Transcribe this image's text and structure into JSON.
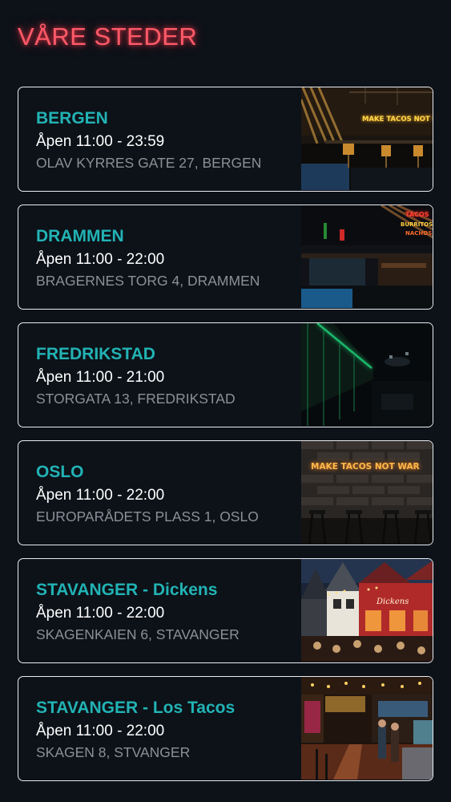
{
  "header": {
    "title": "VÅRE STEDER"
  },
  "colors": {
    "background": "#0c1218",
    "title_neon": "#ff5a68",
    "location_name": "#22b3b5",
    "hours": "#ffffff",
    "address": "#8a9099",
    "card_border": "#e9edf2"
  },
  "locations": [
    {
      "name": "BERGEN",
      "hours": "Åpen 11:00 - 23:59",
      "address": "OLAV KYRRES GATE 27, BERGEN",
      "photo_sign": "MAKE TACOS NOT WAR"
    },
    {
      "name": "DRAMMEN",
      "hours": "Åpen 11:00 - 22:00",
      "address": "BRAGERNES TORG 4, DRAMMEN",
      "photo_sign": "TACOS BURRITOS NACHOS"
    },
    {
      "name": "FREDRIKSTAD",
      "hours": "Åpen 11:00 - 21:00",
      "address": "STORGATA 13, FREDRIKSTAD",
      "photo_sign": ""
    },
    {
      "name": "OSLO",
      "hours": "Åpen 11:00 - 22:00",
      "address": "EUROPARÅDETS PLASS 1, OSLO",
      "photo_sign": "MAKE TACOS NOT WAR"
    },
    {
      "name": "STAVANGER - Dickens",
      "hours": "Åpen 11:00 - 22:00",
      "address": "SKAGENKAIEN 6, STAVANGER",
      "photo_sign": "Dickens"
    },
    {
      "name": "STAVANGER - Los Tacos",
      "hours": "Åpen 11:00 - 22:00",
      "address": "SKAGEN 8, STVANGER",
      "photo_sign": ""
    }
  ]
}
